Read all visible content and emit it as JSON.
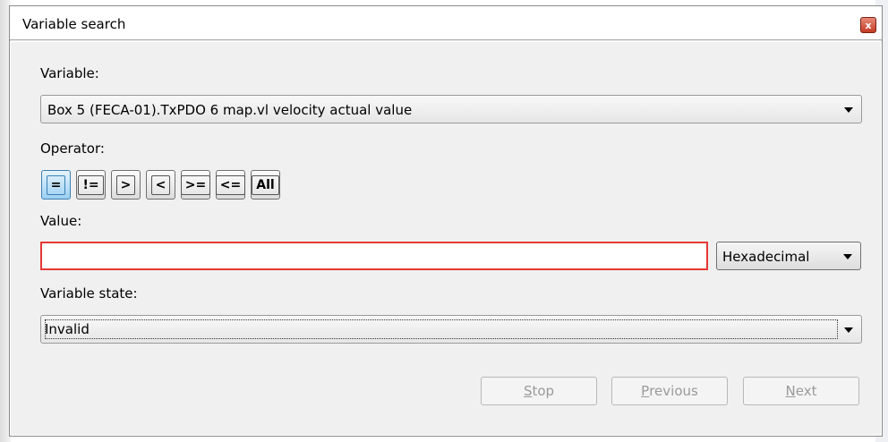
{
  "window": {
    "title": "Variable search",
    "close_glyph": "x"
  },
  "variable": {
    "label": "Variable:",
    "selected": "Box 5 (FECA-01).TxPDO 6 map.vl velocity actual value"
  },
  "operator": {
    "label": "Operator:",
    "buttons": [
      "=",
      "!=",
      ">",
      "<",
      ">=",
      "<=",
      "All"
    ],
    "selected": "="
  },
  "value": {
    "label": "Value:",
    "text": "",
    "format": "Hexadecimal"
  },
  "variable_state": {
    "label": "Variable state:",
    "selected": "Invalid"
  },
  "actions": {
    "stop": {
      "first": "S",
      "rest": "top"
    },
    "previous": {
      "first": "P",
      "rest": "revious"
    },
    "next": {
      "first": "N",
      "rest": "ext"
    }
  },
  "colors": {
    "accent_selected_button": "#9bd0f3",
    "error_border": "#e53935",
    "close_button": "#c33b24"
  }
}
